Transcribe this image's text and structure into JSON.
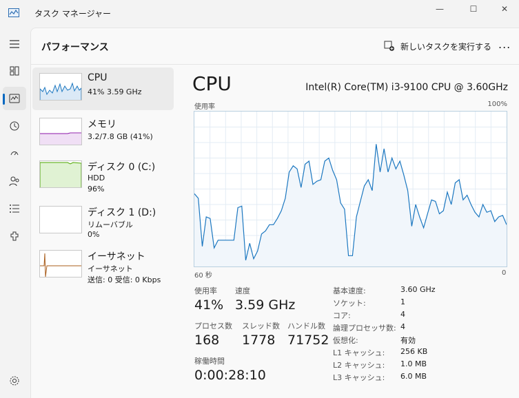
{
  "app": {
    "title": "タスク マネージャー"
  },
  "window_controls": {
    "minimize": "—",
    "maximize": "☐",
    "close": "✕"
  },
  "nav": [
    "menu-icon",
    "processes-icon",
    "performance-icon",
    "history-icon",
    "startup-icon",
    "users-icon",
    "details-icon",
    "services-icon",
    "settings-icon"
  ],
  "header": {
    "title": "パフォーマンス",
    "new_task": "新しいタスクを実行する",
    "more": "..."
  },
  "sidebar": [
    {
      "name": "CPU",
      "line1": "41%  3.59 GHz",
      "line2": "",
      "color": "#1b77c0"
    },
    {
      "name": "メモリ",
      "line1": "3.2/7.8 GB (41%)",
      "line2": "",
      "color": "#8b16a8"
    },
    {
      "name": "ディスク 0 (C:)",
      "line1": "HDD",
      "line2": "96%",
      "color": "#4da600"
    },
    {
      "name": "ディスク 1 (D:)",
      "line1": "リムーバブル",
      "line2": "0%",
      "color": "#4da600"
    },
    {
      "name": "イーサネット",
      "line1": "イーサネット",
      "line2": "送信: 0 受信: 0 Kbps",
      "color": "#a85c1a"
    }
  ],
  "detail": {
    "title": "CPU",
    "model": "Intel(R) Core(TM) i3-9100 CPU @ 3.60GHz",
    "graph_label": "使用率",
    "graph_max": "100%",
    "graph_left": "60 秒",
    "graph_right": "0"
  },
  "chart_data": {
    "type": "area",
    "ylim": [
      0,
      100
    ],
    "values": [
      47,
      44,
      13,
      32,
      31,
      12,
      17,
      17,
      17,
      17,
      17,
      38,
      39,
      4,
      15,
      5,
      10,
      21,
      23,
      27,
      27,
      31,
      36,
      44,
      61,
      65,
      63,
      51,
      66,
      68,
      53,
      55,
      56,
      68,
      70,
      62,
      56,
      41,
      37,
      7,
      7,
      32,
      42,
      52,
      56,
      49,
      79,
      61,
      76,
      61,
      70,
      63,
      68,
      59,
      49,
      26,
      40,
      32,
      25,
      34,
      43,
      42,
      34,
      36,
      48,
      40,
      54,
      56,
      43,
      46,
      40,
      35,
      32,
      40,
      35,
      36,
      29,
      32,
      33,
      27
    ]
  },
  "stats": {
    "usage_label": "使用率",
    "usage": "41%",
    "speed_label": "速度",
    "speed": "3.59 GHz",
    "proc_label": "プロセス数",
    "proc": "168",
    "thread_label": "スレッド数",
    "thread": "1778",
    "handle_label": "ハンドル数",
    "handle": "71752",
    "uptime_label": "稼働時間",
    "uptime": "0:00:28:10"
  },
  "specs": [
    {
      "k": "基本速度:",
      "v": "3.60 GHz"
    },
    {
      "k": "ソケット:",
      "v": "1"
    },
    {
      "k": "コア:",
      "v": "4"
    },
    {
      "k": "論理プロセッサ数:",
      "v": "4"
    },
    {
      "k": "仮想化:",
      "v": "有効"
    },
    {
      "k": "L1 キャッシュ:",
      "v": "256 KB"
    },
    {
      "k": "L2 キャッシュ:",
      "v": "1.0 MB"
    },
    {
      "k": "L3 キャッシュ:",
      "v": "6.0 MB"
    }
  ]
}
